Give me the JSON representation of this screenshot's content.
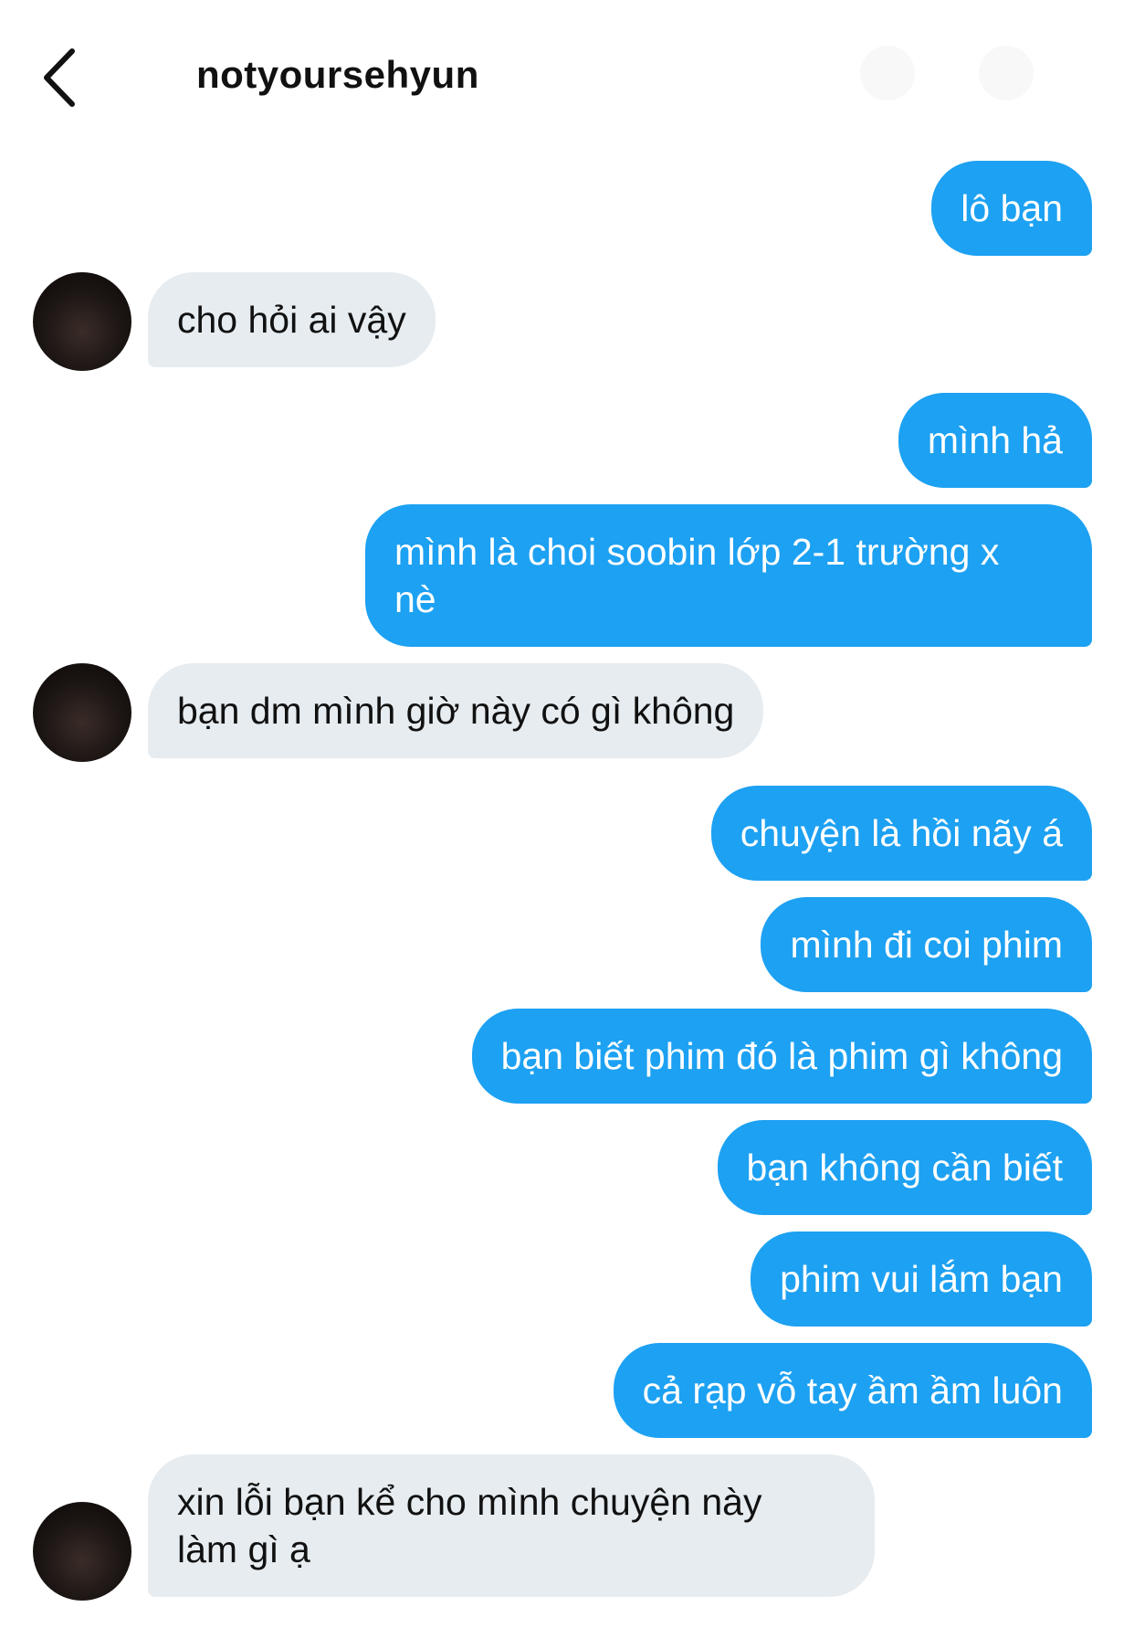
{
  "header": {
    "back_icon": "chevron-left-icon",
    "title": "notyoursehyun"
  },
  "messages": [
    {
      "side": "sent",
      "text": "lô bạn"
    },
    {
      "side": "received",
      "text": "cho hỏi ai vậy"
    },
    {
      "side": "sent",
      "text": "mình hả"
    },
    {
      "side": "sent",
      "text": "mình là choi soobin lớp 2-1 trường x\nnè"
    },
    {
      "side": "received",
      "text": "bạn dm mình giờ này có gì không"
    },
    {
      "side": "sent",
      "text": "chuyện là hồi nãy á"
    },
    {
      "side": "sent",
      "text": "mình đi coi phim"
    },
    {
      "side": "sent",
      "text": "bạn biết phim đó là phim gì không"
    },
    {
      "side": "sent",
      "text": "bạn không cần biết"
    },
    {
      "side": "sent",
      "text": "phim vui lắm bạn"
    },
    {
      "side": "sent",
      "text": "cả rạp vỗ tay ầm ầm luôn"
    },
    {
      "side": "received",
      "text": "xin lỗi bạn kể cho mình chuyện này\nlàm gì ạ"
    }
  ],
  "colors": {
    "sent_bubble": "#1da1f2",
    "received_bubble": "#e6ecf0",
    "text": "#111111"
  }
}
